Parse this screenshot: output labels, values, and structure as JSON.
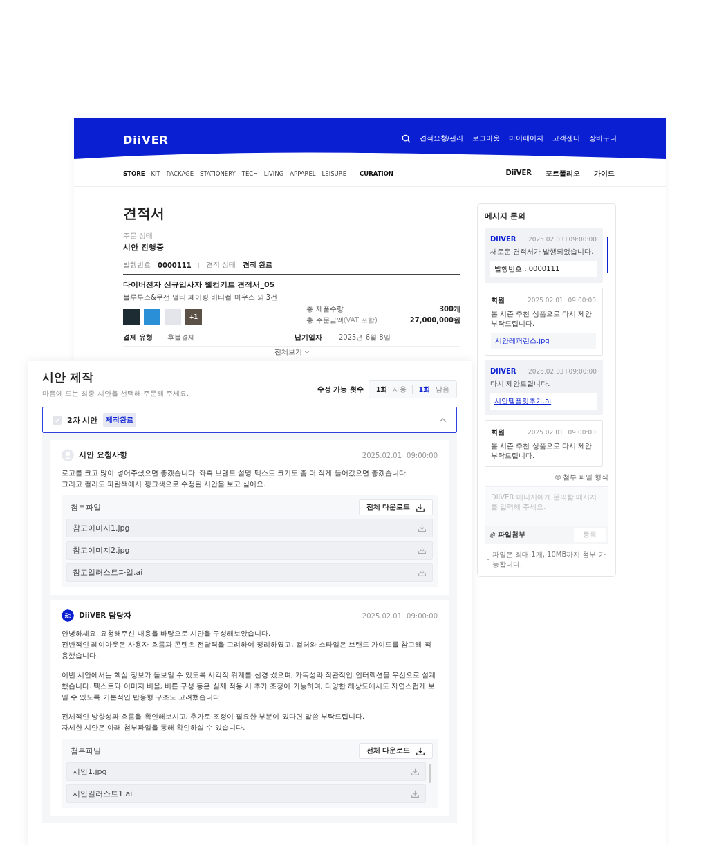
{
  "header": {
    "logo": "DiiVER",
    "links": [
      "견적요청/관리",
      "로그아웃",
      "마이페이지",
      "고객센터",
      "장바구니"
    ]
  },
  "nav": {
    "categories": [
      {
        "label": "STORE",
        "selected": true
      },
      {
        "label": "KIT",
        "selected": false
      },
      {
        "label": "PACKAGE",
        "selected": false
      },
      {
        "label": "STATIONERY",
        "selected": false
      },
      {
        "label": "TECH",
        "selected": false
      },
      {
        "label": "LIVING",
        "selected": false
      },
      {
        "label": "APPAREL",
        "selected": false
      },
      {
        "label": "LEISURE",
        "selected": false
      }
    ],
    "curation": "CURATION",
    "right": [
      "DiiVER",
      "포트폴리오",
      "가이드"
    ]
  },
  "quote": {
    "title": "견적서",
    "status_label": "주문 상태",
    "status": "시안 진행중",
    "meta": [
      {
        "label": "발행번호",
        "value": "0000111"
      },
      {
        "label": "견적 상태",
        "value": "견적 완료"
      }
    ],
    "name": "다이버전자 신규입사자 웰컴키트 견적서_05",
    "products": "블루투스&무선 멀티 페어링 버티컬 마우스 외 3건",
    "thumbnails": [
      {
        "kind": "photo"
      },
      {
        "kind": "photo"
      },
      {
        "kind": "photo"
      },
      {
        "kind": "more",
        "label": "+1"
      }
    ],
    "totals": [
      {
        "label": "총 제품수량",
        "value": "300개"
      },
      {
        "label": "총 주문금액",
        "note": "(VAT 포함)",
        "value": "27,000,000원"
      }
    ],
    "details": [
      {
        "label": "결제 유형",
        "value": "후불결제"
      },
      {
        "label": "납기일자",
        "value": "2025년 6월 8일"
      }
    ],
    "expand": "전체보기"
  },
  "messages": {
    "title": "메시지 문의",
    "items": [
      {
        "kind": "diiver",
        "author": "DiiVER",
        "date": "2025.02.03",
        "time": "09:00:00",
        "text": "새로운 견적서가 발행되었습니다.",
        "attachment": {
          "kind": "text",
          "label": "발행번호 : 0000111"
        }
      },
      {
        "kind": "member",
        "author": "회원",
        "date": "2025.02.01",
        "time": "09:00:00",
        "text": "봄 시즌 추천 상품으로 다시 제안 부탁드립니다.",
        "attachment": {
          "kind": "link",
          "label": "시안레퍼런스.jpg"
        }
      },
      {
        "kind": "diiver",
        "author": "DiiVER",
        "date": "2025.02.03",
        "time": "09:00:00",
        "text": "다시 제안드립니다.",
        "attachment": {
          "kind": "link",
          "label": "시안템플릿추가.ai"
        }
      },
      {
        "kind": "member",
        "author": "회원",
        "date": "2025.02.01",
        "time": "09:00:00",
        "text": "봄 시즌 추천 상품으로 다시 제안 부탁드립니다."
      }
    ],
    "format_hint": "첨부 파일 형식",
    "placeholder": "DiiVER 매니저에게 문의할 메시지를 입력해 주세요.",
    "attach": "파일첨부",
    "submit": "등록",
    "submit_disabled": true,
    "note": "파일은 최대 1개, 10MB까지 첨부 가능합니다."
  },
  "draft": {
    "title": "시안 제작",
    "subtitle": "마음에 드는 최종 시안을 선택해 주문해 주세요.",
    "revisions": {
      "label": "수정 가능 횟수",
      "used_count": "1회",
      "used_label": "사용",
      "left_count": "1회",
      "left_label": "남음"
    },
    "section": {
      "title": "2차 시안",
      "badge": "제작완료",
      "checked": false,
      "expanded": true
    },
    "posts": [
      {
        "kind": "member",
        "author": "시안 요청사항",
        "date": "2025.02.01",
        "time": "09:00:00",
        "paragraphs": [
          "로고를 크고 많이 넣어주셨으면 좋겠습니다. 좌측 브랜드 설명 텍스트 크기도 좀 더 작게 들어갔으면 좋겠습니다.\n그리고 컬러도 파란색에서 핑크색으로 수정된 시안을 보고 싶어요."
        ],
        "files_label": "첨부파일",
        "download_all": "전체 다운로드",
        "files": [
          "참고이미지1.jpg",
          "참고이미지2.jpg",
          "참고일러스트파일.ai"
        ]
      },
      {
        "kind": "manager",
        "author": "DiiVER 담당자",
        "date": "2025.02.01",
        "time": "09:00:00",
        "paragraphs": [
          "안녕하세요. 요청해주신 내용을 바탕으로 시안을 구성해보았습니다.\n전반적인 레이아웃은 사용자 흐름과 콘텐츠 전달력을 고려하여 정리하였고, 컬러와 스타일은 브랜드 가이드를 참고해 적용했습니다.",
          "이번 시안에서는 핵심 정보가 돋보일 수 있도록 시각적 위계를 신경 썼으며, 가독성과 직관적인 인터랙션을 우선으로 설계했습니다. 텍스트와 이미지 비율, 버튼 구성 등은 실제 적용 시 추가 조정이 가능하며, 다양한 해상도에서도 자연스럽게 보일 수 있도록 기본적인 반응형 구조도 고려했습니다.",
          "전체적인 방향성과 흐름을 확인해보시고, 추가로 조정이 필요한 부분이 있다면 말씀 부탁드립니다.\n자세한 시안은 아래 첨부파일을 통해 확인하실 수 있습니다."
        ],
        "files_label": "첨부파일",
        "download_all": "전체 다운로드",
        "files": [
          "시안1.jpg",
          "시안일러스트1.ai"
        ]
      }
    ]
  }
}
